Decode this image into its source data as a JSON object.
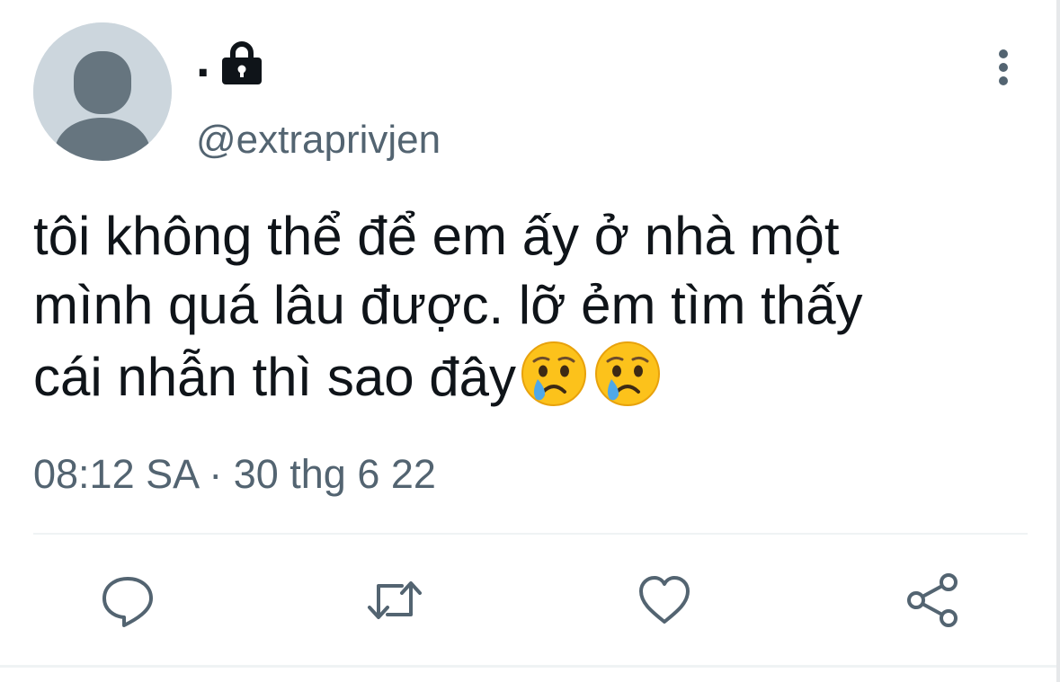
{
  "tweet": {
    "display_name": ".",
    "handle": "@extraprivjen",
    "locked": true,
    "text_lines": [
      "tôi không thể để em ấy ở nhà một",
      "mình quá lâu được. lỡ ẻm tìm thấy",
      "cái nhẫn thì sao đây"
    ],
    "emojis": [
      "crying-face",
      "crying-face"
    ],
    "time": "08:12 SA",
    "separator": "·",
    "date": "30 thg 6 22"
  },
  "icons": {
    "lock": "lock-icon",
    "more": "more-vertical-icon",
    "reply": "reply-icon",
    "retweet": "retweet-icon",
    "like": "heart-icon",
    "share": "share-icon"
  },
  "colors": {
    "text": "#0f1419",
    "secondary": "#536471",
    "avatar_bg": "#ccd6dd",
    "avatar_fg": "#66757f",
    "divider": "#eff3f4"
  }
}
